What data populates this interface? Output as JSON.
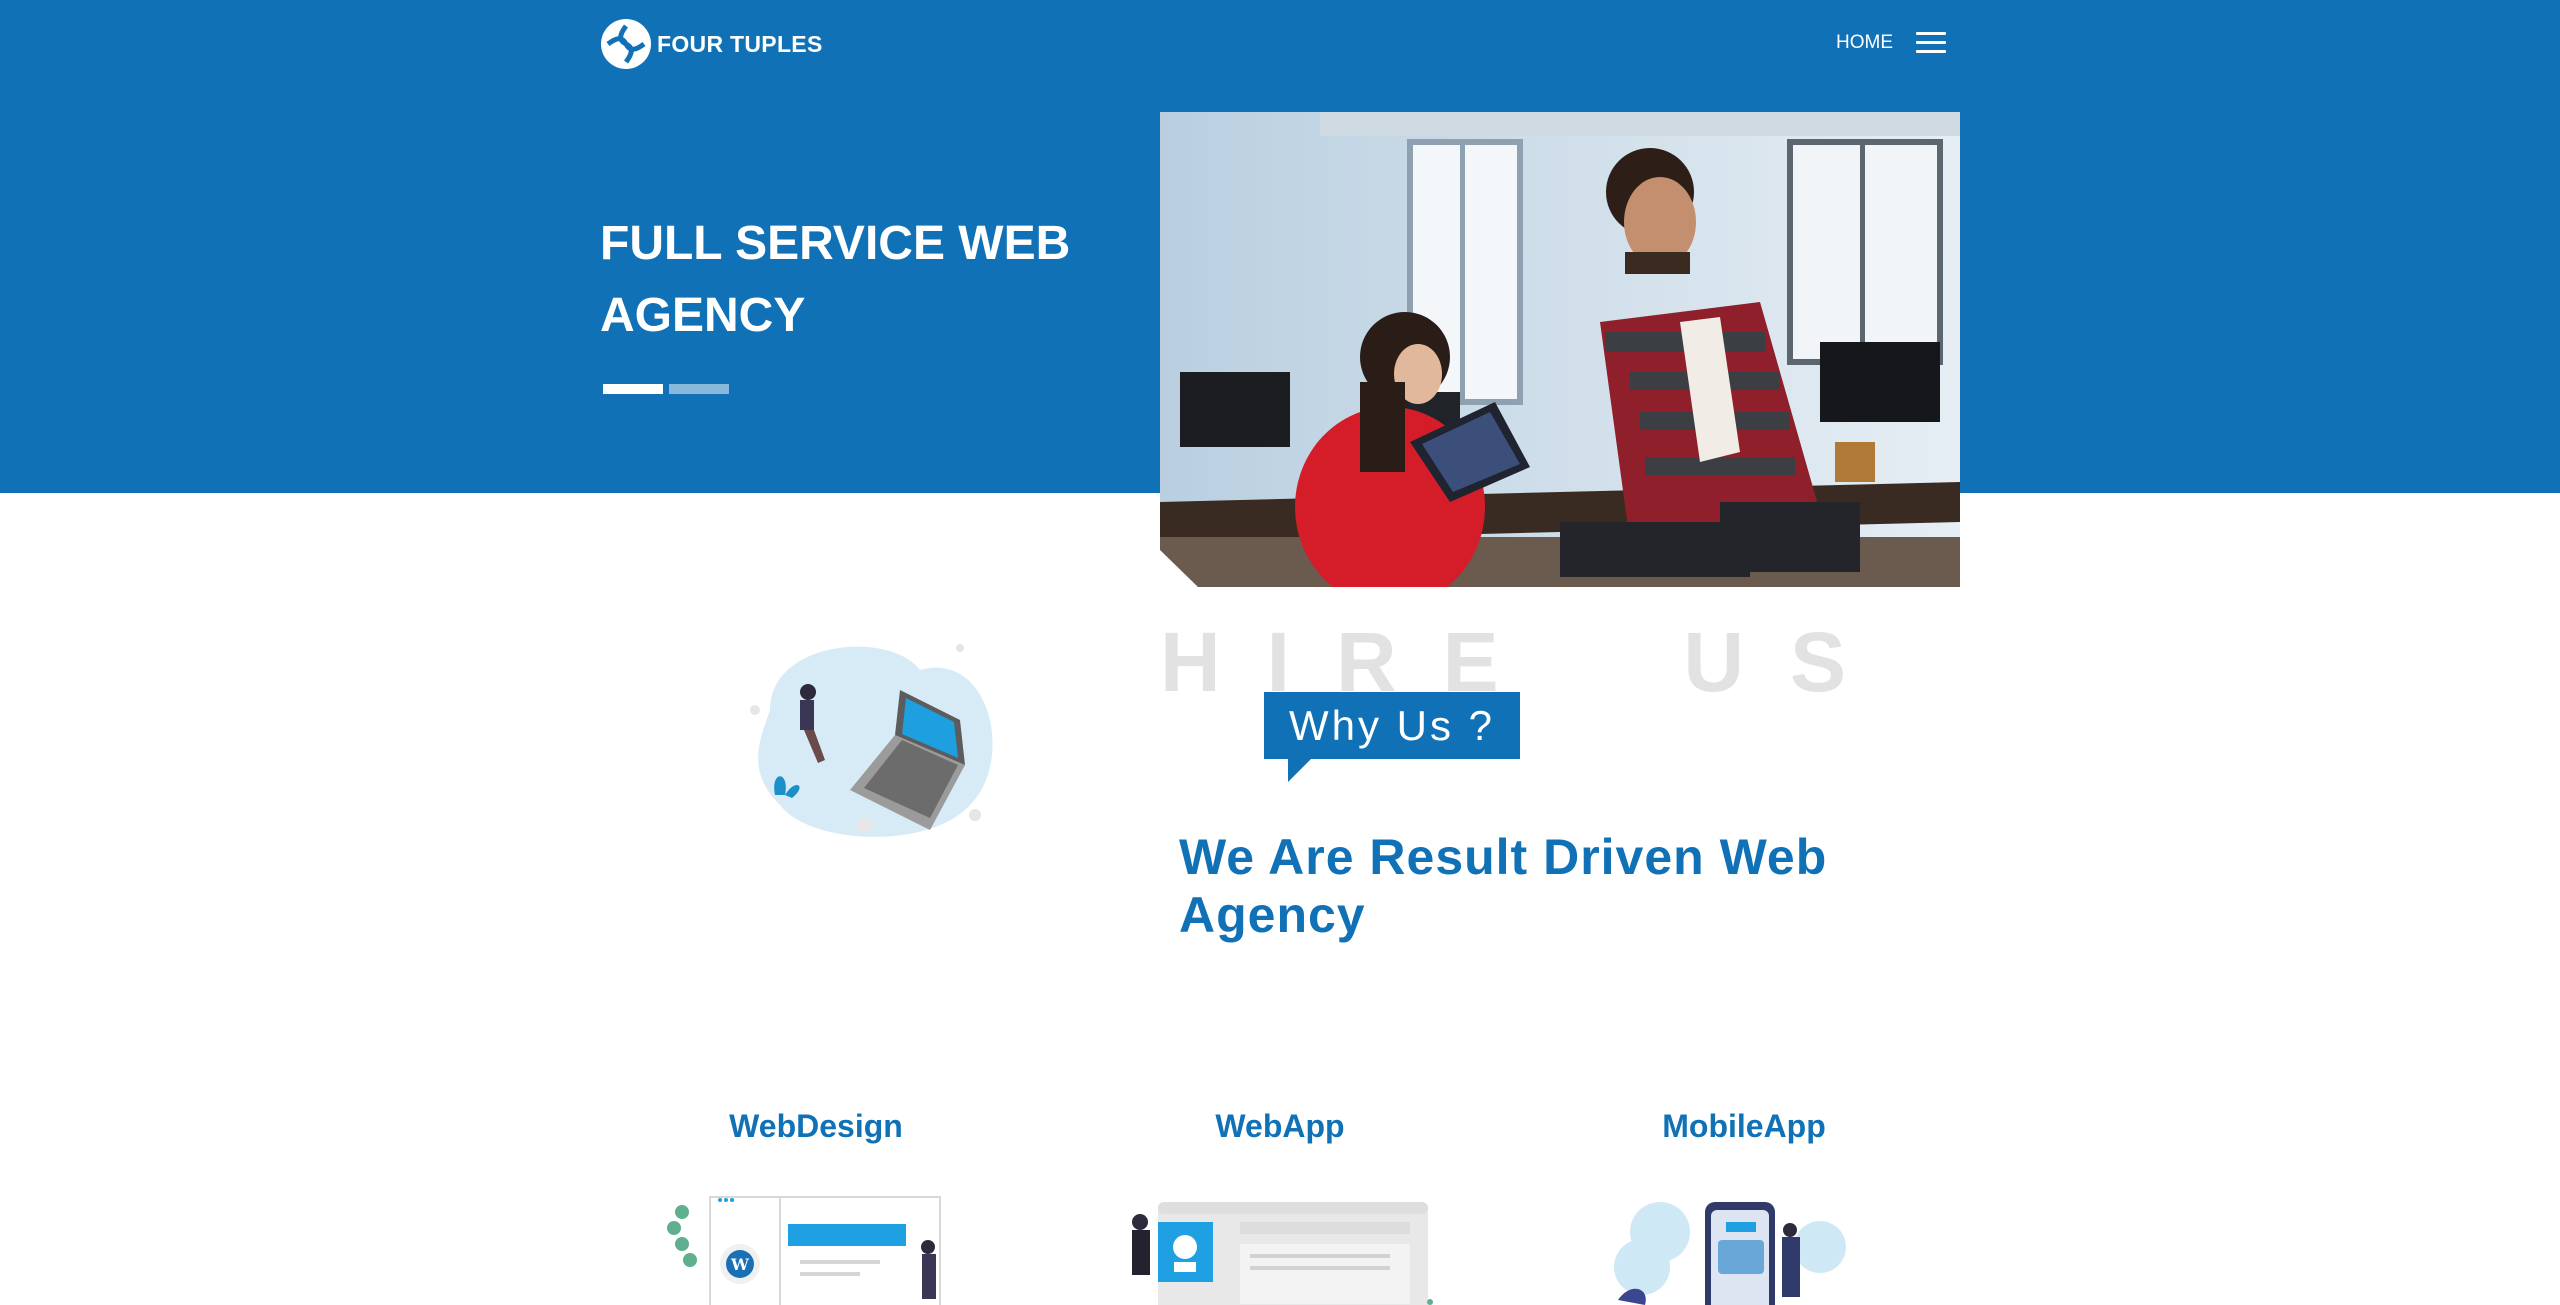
{
  "nav": {
    "brand": "FOUR TUPLES",
    "home_label": "HOME",
    "menu_icon": "hamburger-menu-icon"
  },
  "hero": {
    "title": "FULL SERVICE WEB AGENCY",
    "slide_count": 2,
    "active_slide": 1,
    "image_alt": "Two colleagues looking at a tablet in an office"
  },
  "about": {
    "watermark": "HIRE  US",
    "badge": "Why Us ?",
    "heading": "We Are Result Driven Web Agency"
  },
  "services": [
    {
      "bold": "Web",
      "rest": "Design",
      "icon": "web-design-illustration"
    },
    {
      "bold": "Web",
      "rest": "App",
      "icon": "web-app-illustration"
    },
    {
      "bold": "Mobile",
      "rest": "App",
      "icon": "mobile-app-illustration"
    }
  ],
  "colors": {
    "brand_blue": "#1071b6",
    "watermark_gray": "#e2e2e2"
  }
}
